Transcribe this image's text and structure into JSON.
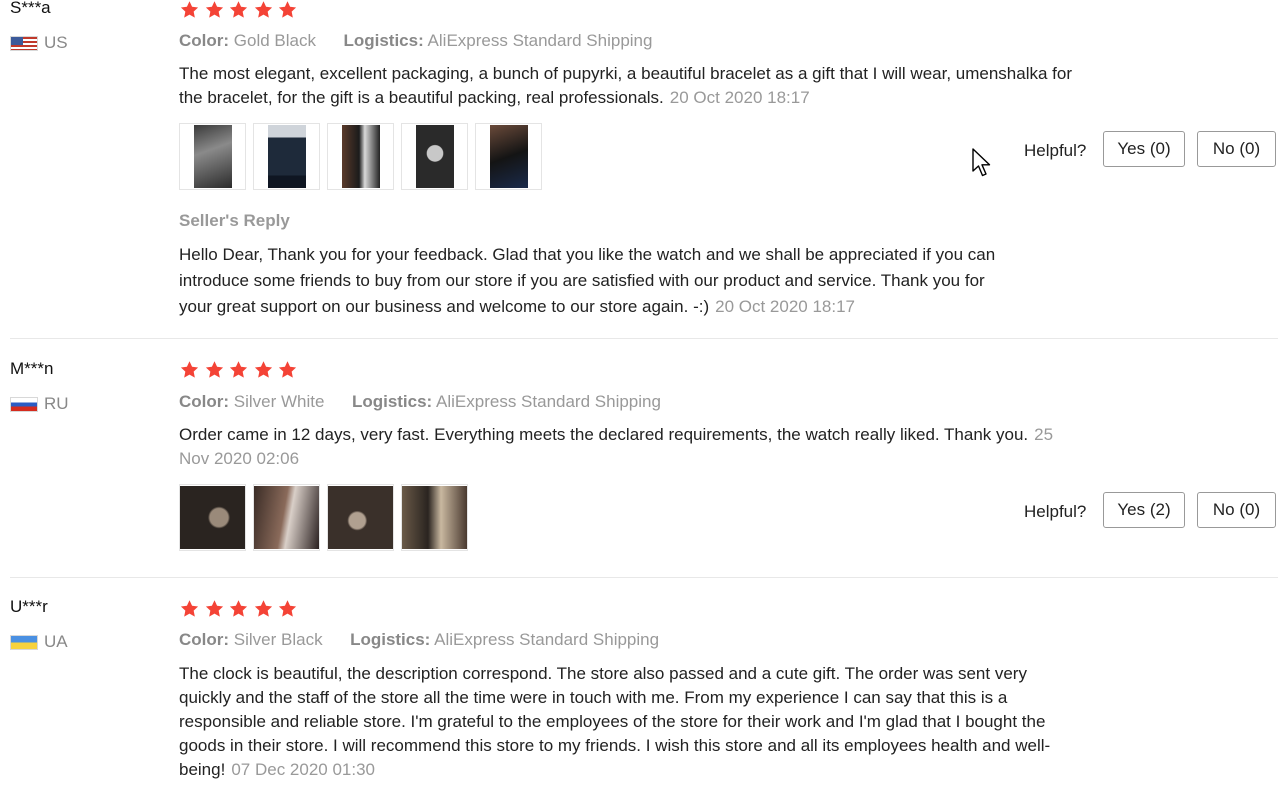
{
  "reviews": [
    {
      "user": "S***a",
      "country": "US",
      "rating": 5,
      "color_label": "Color:",
      "color_value": "Gold Black",
      "logistics_label": "Logistics:",
      "logistics_value": "AliExpress Standard Shipping",
      "text_line1": "The most elegant, excellent packaging, a bunch of pupyrki, a beautiful bracelet as a gift that I will wear, umenshalka for",
      "text_line2": "the bracelet, for the gift is a beautiful packing, real professionals.",
      "date": "20 Oct 2020 18:17",
      "helpful_label": "Helpful?",
      "yes_label": "Yes (0)",
      "no_label": "No (0)",
      "seller_reply_title": "Seller's Reply",
      "reply_line1": "Hello Dear, Thank you for your feedback. Glad that you like the watch and we shall be appreciated if you can",
      "reply_line2": "introduce some friends to buy from our store if you are satisfied with our product and service. Thank you for",
      "reply_line3": "your great support on our business and welcome to our store again. -:)",
      "reply_date": "20 Oct 2020 18:17"
    },
    {
      "user": "M***n",
      "country": "RU",
      "rating": 5,
      "color_label": "Color:",
      "color_value": "Silver White",
      "logistics_label": "Logistics:",
      "logistics_value": "AliExpress Standard Shipping",
      "text_line1": "Order came in 12 days, very fast. Everything meets the declared requirements, the watch really liked. Thank you.",
      "date_part1": "25",
      "date_part2": "Nov 2020 02:06",
      "helpful_label": "Helpful?",
      "yes_label": "Yes (2)",
      "no_label": "No (0)"
    },
    {
      "user": "U***r",
      "country": "UA",
      "rating": 5,
      "color_label": "Color:",
      "color_value": "Silver Black",
      "logistics_label": "Logistics:",
      "logistics_value": "AliExpress Standard Shipping",
      "text_line1": "The clock is beautiful, the description correspond. The store also passed and a cute gift. The order was sent very",
      "text_line2": "quickly and the staff of the store all the time were in touch with me. From my experience I can say that this is a",
      "text_line3": "responsible and reliable store. I'm grateful to the employees of the store for their work and I'm glad that I bought the",
      "text_line4": "goods in their store. I will recommend this store to my friends. I wish this store and all its employees health and well-",
      "text_line5": "being!",
      "date": "07 Dec 2020 01:30"
    }
  ],
  "colors": {
    "star": "#f44336",
    "muted_text": "#999999",
    "border": "#999999"
  }
}
